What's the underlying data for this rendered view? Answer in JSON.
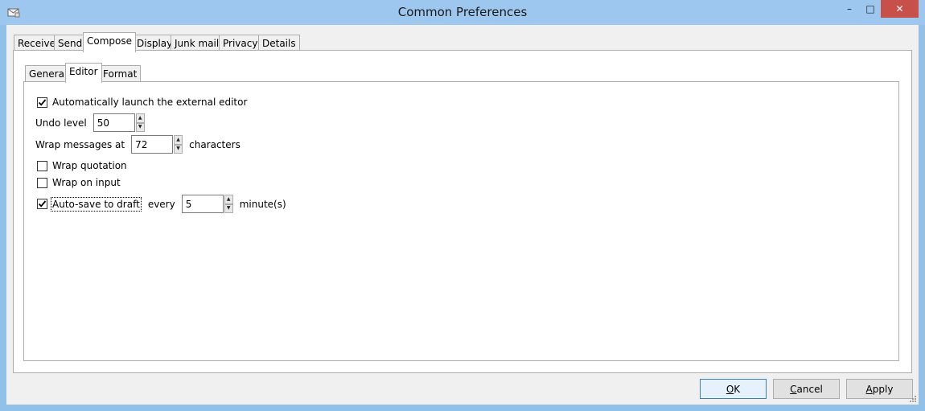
{
  "window": {
    "title": "Common Preferences",
    "icon": "mail-app-icon",
    "controls": {
      "minimize": "–",
      "maximize": "□",
      "close": "✕"
    }
  },
  "tabs": [
    "Receive",
    "Send",
    "Compose",
    "Display",
    "Junk mail",
    "Privacy",
    "Details"
  ],
  "active_tab": "Compose",
  "subtabs": [
    "General",
    "Editor",
    "Format"
  ],
  "active_subtab": "Editor",
  "editor": {
    "auto_launch": {
      "label": "Automatically launch the external editor",
      "checked": true
    },
    "undo_level": {
      "label": "Undo level",
      "value": "50"
    },
    "wrap_messages": {
      "label": "Wrap messages at",
      "value": "72",
      "suffix": "characters"
    },
    "wrap_quotation": {
      "label": "Wrap quotation",
      "checked": false
    },
    "wrap_on_input": {
      "label": "Wrap on input",
      "checked": false
    },
    "auto_save": {
      "label": "Auto-save to draft",
      "checked": true,
      "every_label": "every",
      "value": "5",
      "suffix": "minute(s)"
    }
  },
  "buttons": {
    "ok": {
      "mnemonic": "O",
      "rest": "K"
    },
    "cancel": {
      "mnemonic": "C",
      "rest": "ancel"
    },
    "apply": {
      "mnemonic": "A",
      "rest": "pply"
    }
  },
  "colors": {
    "titlebar": "#9dc7ee",
    "close": "#c7504b",
    "default_button_border": "#3c7fb1"
  }
}
